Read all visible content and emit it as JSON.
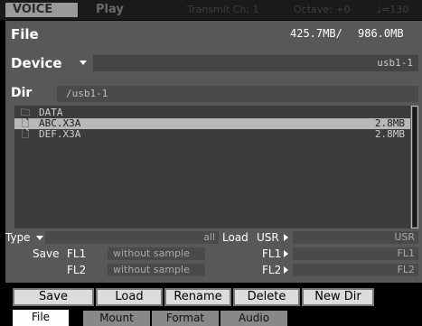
{
  "status_bar": {
    "mode": "VOICE",
    "play": "Play",
    "transmit": "Transmit Ch: 1",
    "octave": "Octave: +0",
    "tempo": "♩=130"
  },
  "file_panel": {
    "title": "File",
    "memory_used": "425.7MB/",
    "memory_total": "986.0MB"
  },
  "device": {
    "label": "Device",
    "value": "usb1-1"
  },
  "dir": {
    "label": "Dir",
    "path": "/usb1-1"
  },
  "files": [
    {
      "icon": "folder-icon",
      "glyph": "🗀",
      "name": "DATA",
      "size": ""
    },
    {
      "icon": "file-icon",
      "glyph": "🗋",
      "name": "ABC.X3A",
      "size": "2.8MB"
    },
    {
      "icon": "file-icon",
      "glyph": "🗋",
      "name": "DEF.X3A",
      "size": "2.8MB"
    }
  ],
  "selected_index": 1,
  "type": {
    "label": "Type",
    "value": "all"
  },
  "save": {
    "label": "Save",
    "fl1_label": "FL1",
    "fl1_value": "without sample",
    "fl2_label": "FL2",
    "fl2_value": "without sample"
  },
  "load": {
    "label": "Load",
    "usr_label": "USR",
    "usr_value": "USR",
    "fl1_label": "FL1",
    "fl1_value": "FL1",
    "fl2_label": "FL2",
    "fl2_value": "FL2"
  },
  "buttons": {
    "save": "Save",
    "load": "Load",
    "rename": "Rename",
    "delete": "Delete",
    "new_dir": "New Dir"
  },
  "tabs": [
    "File",
    "Mount",
    "Format",
    "Audio"
  ],
  "active_tab": "File"
}
